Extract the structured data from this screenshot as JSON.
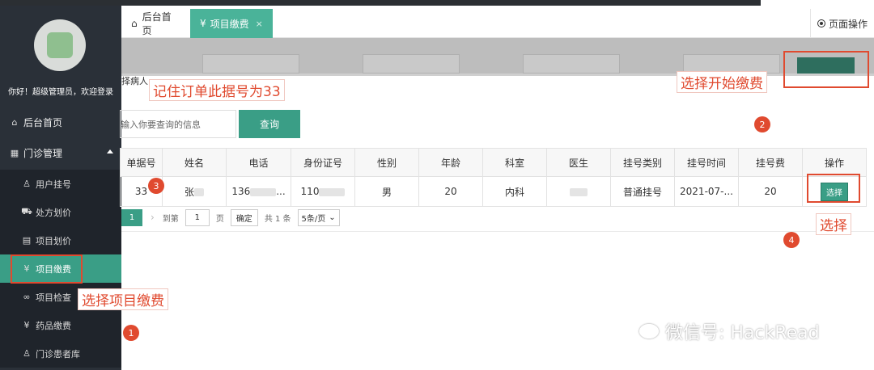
{
  "sidebar": {
    "welcome": "你好！超级管理员，欢迎登录",
    "home": "后台首页",
    "clinic": "门诊管理",
    "items": [
      {
        "label": "用户挂号"
      },
      {
        "label": "处方划价"
      },
      {
        "label": "项目划价"
      },
      {
        "label": "项目缴费"
      },
      {
        "label": "项目检查"
      },
      {
        "label": "药品缴费"
      },
      {
        "label": "门诊患者库"
      }
    ]
  },
  "tabs": {
    "home": "后台首页",
    "active": "项目缴费",
    "close": "×",
    "page_ops": "页面操作"
  },
  "search": {
    "select_patient": "择病人",
    "placeholder": "输入你要查询的信息",
    "button": "查询"
  },
  "table": {
    "headers": [
      "单据号",
      "姓名",
      "电话",
      "身份证号",
      "性别",
      "年龄",
      "科室",
      "医生",
      "挂号类别",
      "挂号时间",
      "挂号费",
      "操作"
    ],
    "row": {
      "id": "33",
      "name": "张",
      "phone": "136",
      "phone_suffix": "...",
      "idcard": "110",
      "gender": "男",
      "age": "20",
      "dept": "内科",
      "type": "普通挂号",
      "time": "2021-07-...",
      "fee": "20",
      "action": "选择"
    }
  },
  "pager": {
    "page": "1",
    "goto": "到第",
    "page_input": "1",
    "page_unit": "页",
    "confirm": "确定",
    "total": "共 1 条",
    "per_page": "5条/页"
  },
  "annotations": {
    "step1": "选择项目缴费",
    "step2": "选择开始缴费",
    "step3": "记住订单此据号为33",
    "step4": "选择",
    "n1": "1",
    "n2": "2",
    "n3": "3",
    "n4": "4"
  },
  "watermark": "微信号: HackRead",
  "colors": {
    "accent": "#3a9e86",
    "sidebar": "#2a3038",
    "annotation": "#e04a2f"
  }
}
